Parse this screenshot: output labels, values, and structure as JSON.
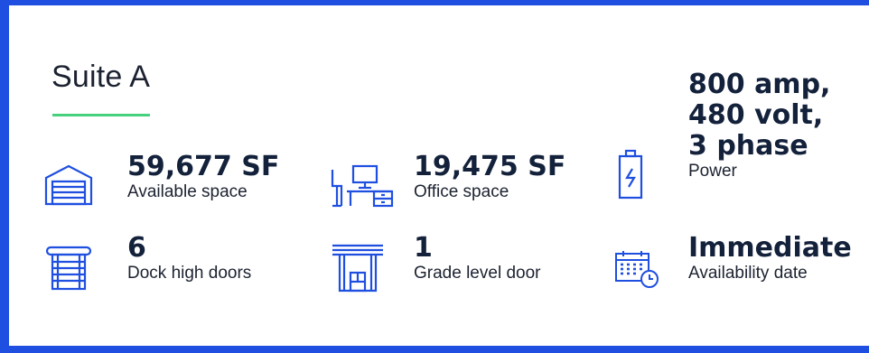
{
  "suite": {
    "title": "Suite A"
  },
  "colors": {
    "border": "#1f4fe0",
    "accent_rule": "#46d17e",
    "icon": "#1f4fe0",
    "text": "#13213b"
  },
  "features": [
    {
      "value": "59,677 SF",
      "label": "Available space",
      "icon": "warehouse-icon"
    },
    {
      "value": "19,475 SF",
      "label": "Office space",
      "icon": "office-desk-icon"
    },
    {
      "value_lines": [
        "800 amp,",
        "480 volt,",
        "3 phase"
      ],
      "label": "Power",
      "icon": "battery-icon"
    },
    {
      "value": "6",
      "label": "Dock high doors",
      "icon": "dock-door-icon"
    },
    {
      "value": "1",
      "label": "Grade level door",
      "icon": "grade-door-icon"
    },
    {
      "value": "Immediate",
      "label": "Availability date",
      "icon": "calendar-clock-icon"
    }
  ]
}
